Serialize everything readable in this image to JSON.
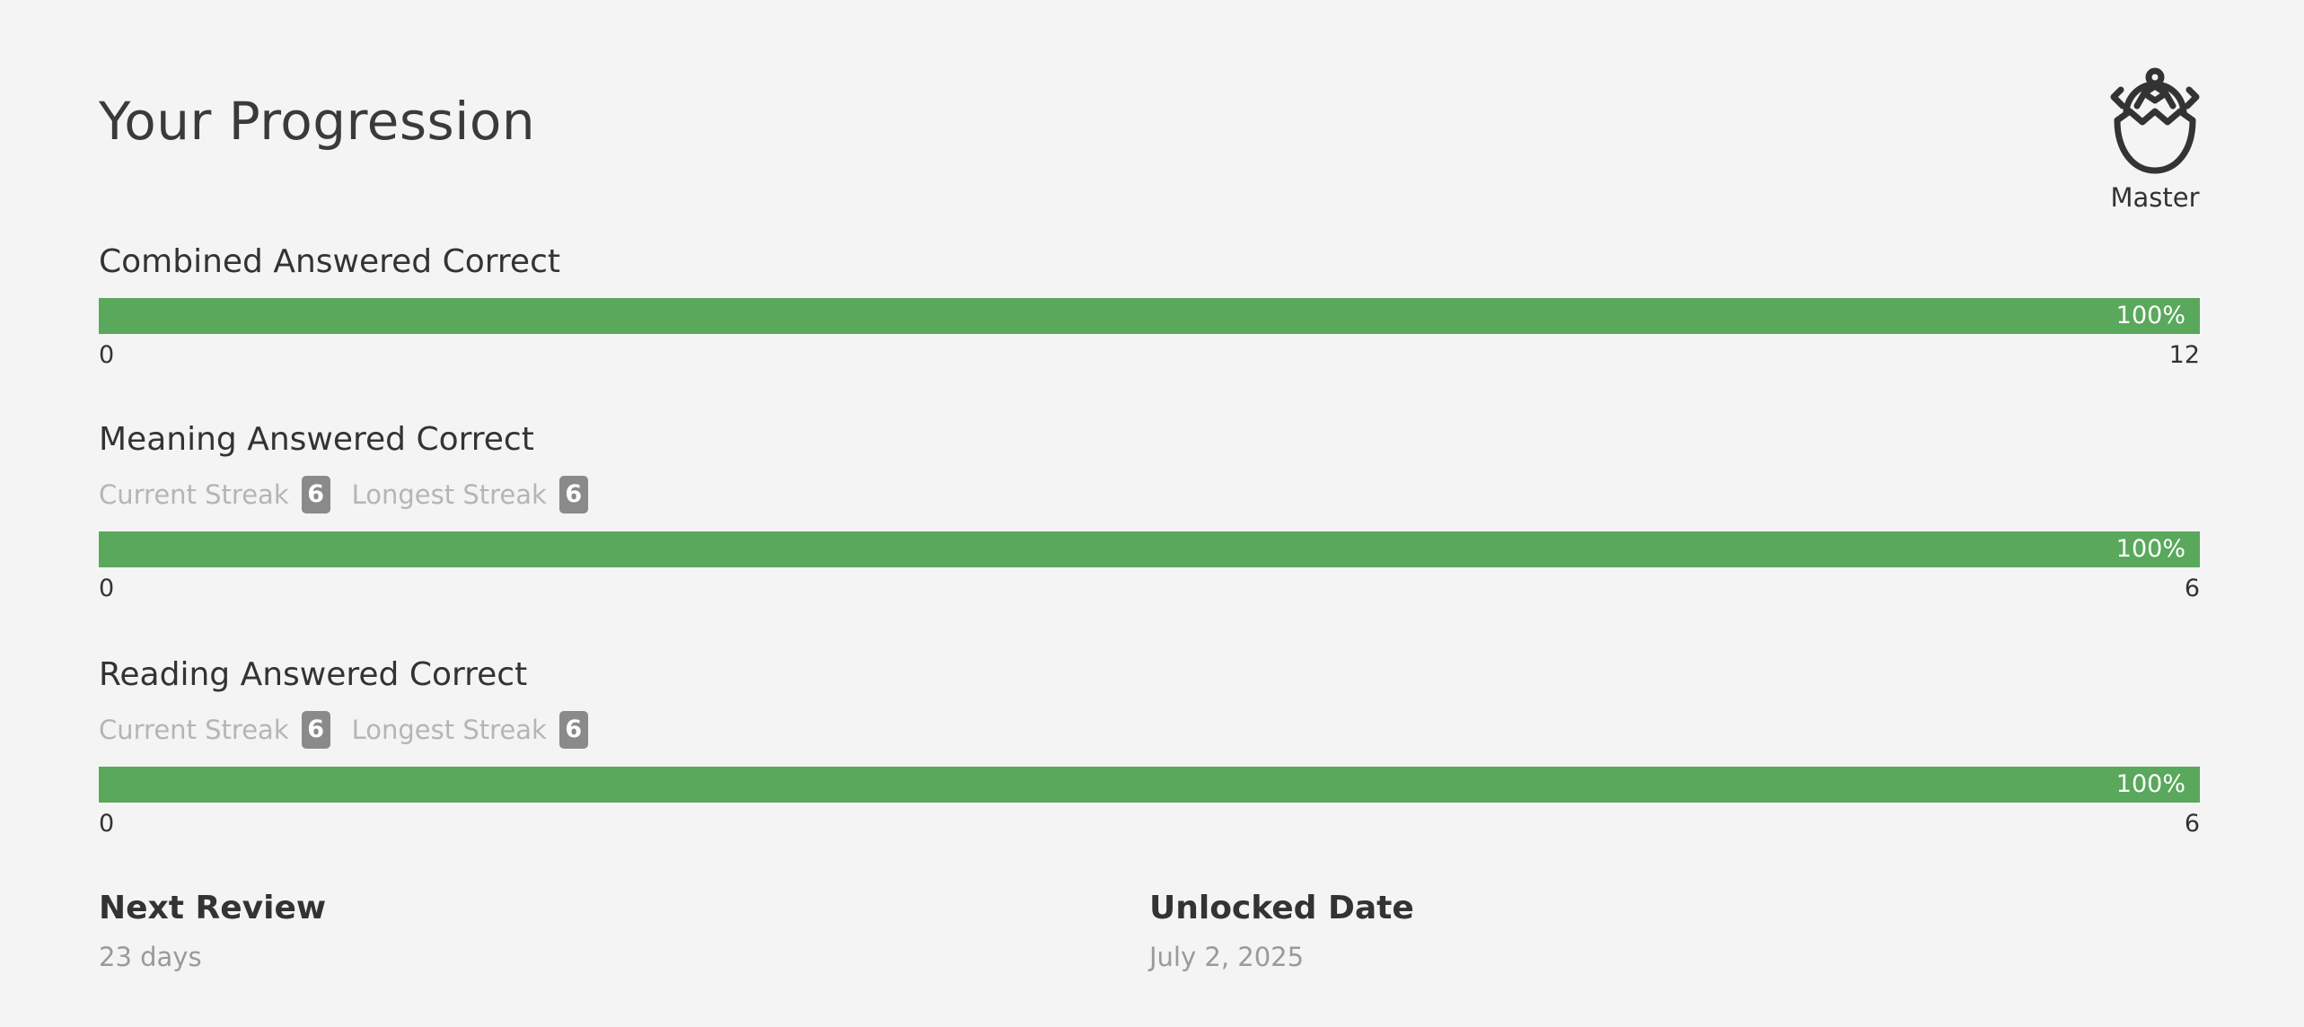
{
  "page": {
    "title": "Your Progression"
  },
  "level": {
    "icon": "turtle-egg-icon",
    "label": "Master"
  },
  "colors": {
    "progress_fill": "#59a85b",
    "badge_bg": "#8a8a8a",
    "background": "#f4f4f4"
  },
  "combined": {
    "heading": "Combined Answered Correct",
    "percent_label": "100%",
    "progress": 1.0,
    "min": "0",
    "max": "12"
  },
  "meaning": {
    "heading": "Meaning Answered Correct",
    "current_streak_label": "Current Streak",
    "current_streak_value": "6",
    "longest_streak_label": "Longest Streak",
    "longest_streak_value": "6",
    "percent_label": "100%",
    "progress": 1.0,
    "min": "0",
    "max": "6"
  },
  "reading": {
    "heading": "Reading Answered Correct",
    "current_streak_label": "Current Streak",
    "current_streak_value": "6",
    "longest_streak_label": "Longest Streak",
    "longest_streak_value": "6",
    "percent_label": "100%",
    "progress": 1.0,
    "min": "0",
    "max": "6"
  },
  "next_review": {
    "heading": "Next Review",
    "value": "23 days"
  },
  "unlocked": {
    "heading": "Unlocked Date",
    "value": "July 2, 2025"
  }
}
